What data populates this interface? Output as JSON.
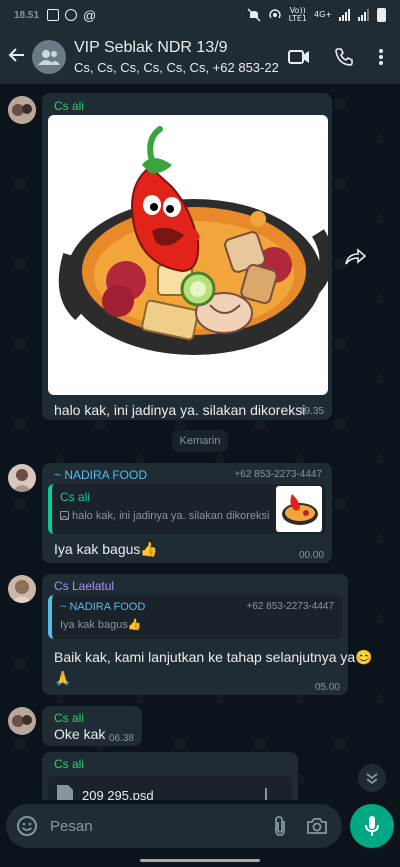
{
  "status_bar": {
    "time": "18.51",
    "network_top": "Vo))",
    "network_mid": "LTE1",
    "network_gen": "4G+"
  },
  "chat_header": {
    "title": "VIP Seblak NDR 13/9",
    "subtitle": "Cs, Cs, Cs, Cs, Cs, Cs, +62 853-22..."
  },
  "messages": [
    {
      "sender": "Cs ali",
      "sender_color": "#25d366",
      "text": "halo kak, ini jadinya ya. silakan dikoreksi",
      "time": "19.35",
      "has_image": true
    },
    {
      "day_separator": "Kemarin"
    },
    {
      "sender": "~ NADIRA FOOD",
      "sender_color": "#53bdeb",
      "sender_phone": "+62 853-2273-4447",
      "quote": {
        "author": "Cs ali",
        "text": "halo kak, ini jadinya ya. silakan dikoreksi"
      },
      "text": "Iya kak bagus👍",
      "time": "00.00"
    },
    {
      "sender": "Cs Laelatul",
      "sender_color": "#a791f5",
      "quote": {
        "author": "~ NADIRA FOOD",
        "author_phone": "+62 853-2273-4447",
        "text": "Iya kak bagus👍"
      },
      "text": "Baik kak, kami lanjutkan ke tahap selanjutnya ya😊",
      "text2": "🙏",
      "time": "05.00"
    },
    {
      "sender": "Cs ali",
      "sender_color": "#25d366",
      "text": "Oke kak",
      "time": "06.38"
    },
    {
      "sender": "Cs ali",
      "sender_color": "#25d366",
      "file_name": "209 295.psd"
    }
  ],
  "input": {
    "placeholder": "Pesan"
  },
  "colors": {
    "bubble": "#202c33",
    "accent": "#00a884",
    "background": "#0b141a"
  },
  "icons": [
    "back-arrow-icon",
    "group-icon",
    "video-call-icon",
    "voice-call-icon",
    "more-vert-icon",
    "forward-icon",
    "emoji-icon",
    "attach-icon",
    "camera-icon",
    "mic-icon",
    "chevron-down-double-icon",
    "file-icon"
  ]
}
